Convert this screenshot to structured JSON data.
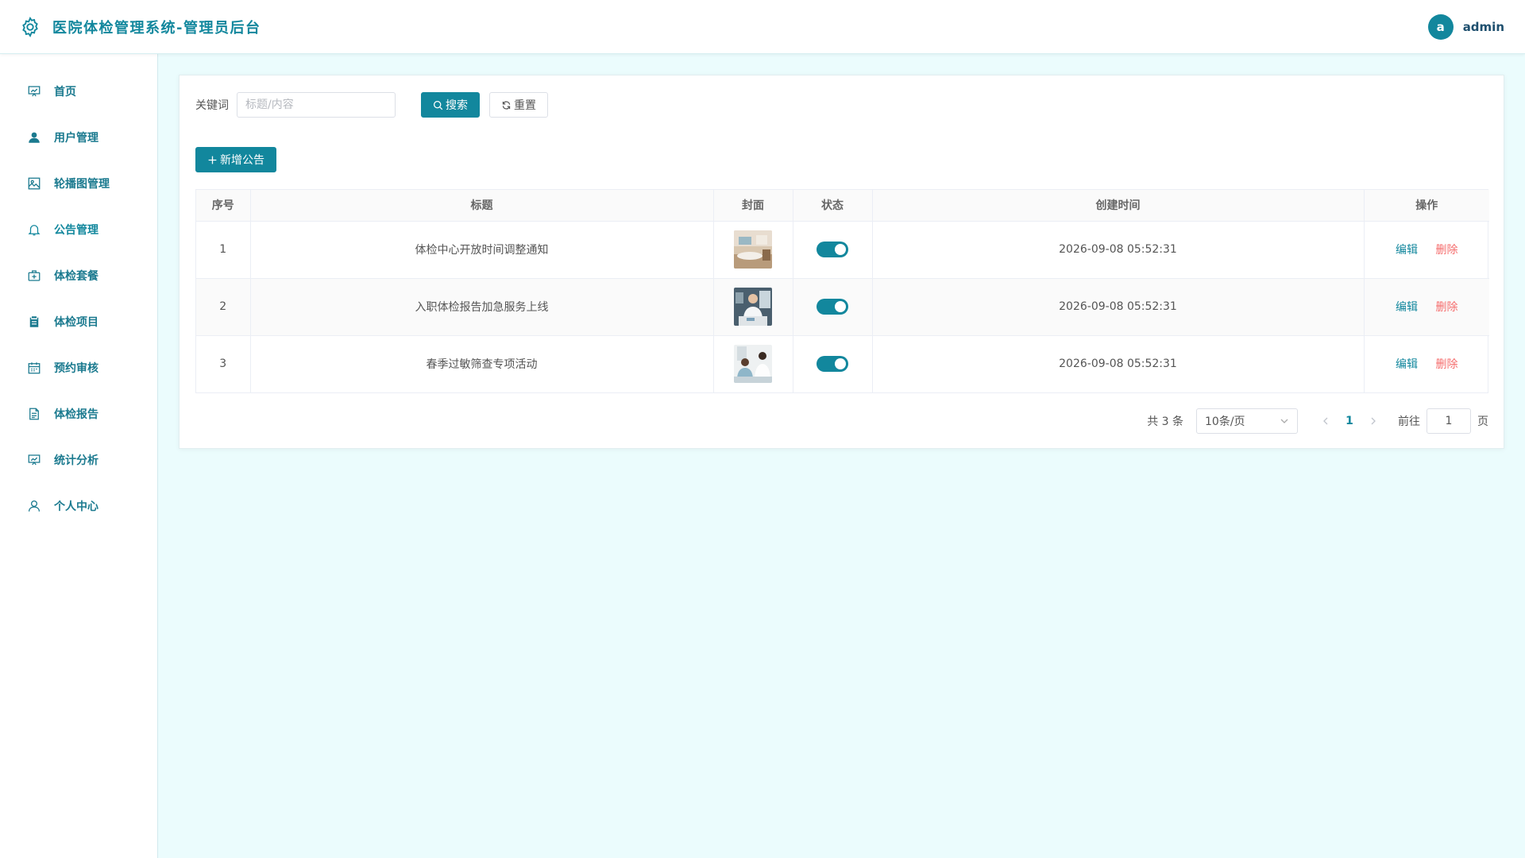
{
  "header": {
    "title": "医院体检管理系统-管理员后台",
    "avatar_letter": "a",
    "username": "admin"
  },
  "sidebar": {
    "items": [
      {
        "label": "首页",
        "icon": "presentation-chart-icon",
        "active": false
      },
      {
        "label": "用户管理",
        "icon": "user-icon",
        "active": false
      },
      {
        "label": "轮播图管理",
        "icon": "image-icon",
        "active": false
      },
      {
        "label": "公告管理",
        "icon": "bell-icon",
        "active": true
      },
      {
        "label": "体检套餐",
        "icon": "medical-box-icon",
        "active": false
      },
      {
        "label": "体检项目",
        "icon": "clipboard-icon",
        "active": false
      },
      {
        "label": "预约审核",
        "icon": "calendar-icon",
        "active": false
      },
      {
        "label": "体检报告",
        "icon": "document-icon",
        "active": false
      },
      {
        "label": "统计分析",
        "icon": "presentation-chart-icon",
        "active": false
      },
      {
        "label": "个人中心",
        "icon": "user-outline-icon",
        "active": false
      }
    ]
  },
  "search": {
    "label": "关键词",
    "placeholder": "标题/内容",
    "value": "",
    "search_button": "搜索",
    "reset_button": "重置"
  },
  "toolbar": {
    "add_button": "新增公告"
  },
  "table": {
    "columns": [
      "序号",
      "标题",
      "封面",
      "状态",
      "创建时间",
      "操作"
    ],
    "rows": [
      {
        "index": "1",
        "title": "体检中心开放时间调整通知",
        "cover": "lobby-image",
        "status_on": true,
        "created": "2026-09-08 05:52:31",
        "edit": "编辑",
        "delete": "删除"
      },
      {
        "index": "2",
        "title": "入职体检报告加急服务上线",
        "cover": "doctor-image",
        "status_on": true,
        "created": "2026-09-08 05:52:31",
        "edit": "编辑",
        "delete": "删除"
      },
      {
        "index": "3",
        "title": "春季过敏筛查专项活动",
        "cover": "consultation-image",
        "status_on": true,
        "created": "2026-09-08 05:52:31",
        "edit": "编辑",
        "delete": "删除"
      }
    ]
  },
  "pagination": {
    "total_text": "共 3 条",
    "page_size": "10条/页",
    "current_page": "1",
    "goto_label": "前往",
    "goto_value": "1",
    "goto_suffix": "页"
  },
  "colors": {
    "accent": "#12879d",
    "danger": "#f56c6c",
    "background": "#ebfcfd"
  }
}
